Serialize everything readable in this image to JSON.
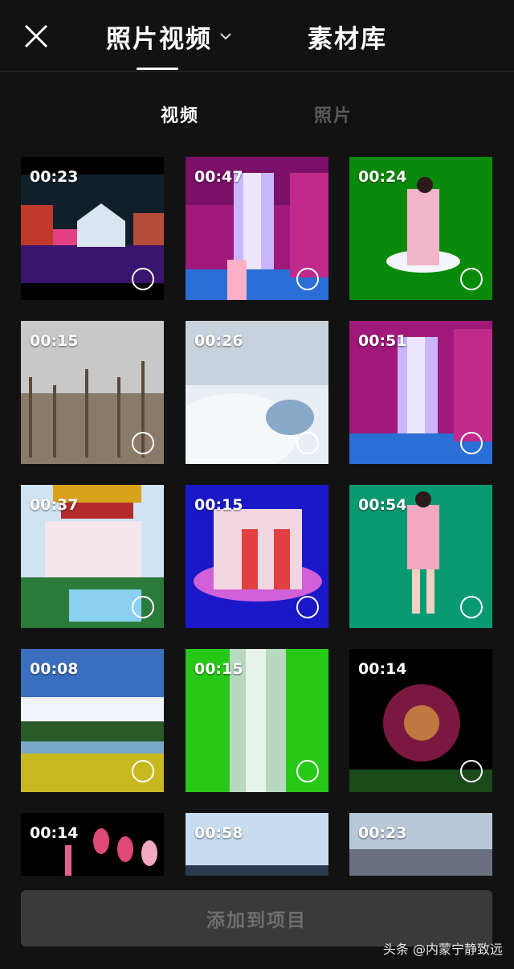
{
  "header": {
    "close_icon": "close-icon",
    "tab_primary": "照片视频",
    "tab_secondary": "素材库"
  },
  "subtabs": {
    "active": "视频",
    "inactive": "照片"
  },
  "tiles": [
    {
      "duration": "00:23"
    },
    {
      "duration": "00:47"
    },
    {
      "duration": "00:24"
    },
    {
      "duration": "00:15"
    },
    {
      "duration": "00:26"
    },
    {
      "duration": "00:51"
    },
    {
      "duration": "00:37"
    },
    {
      "duration": "00:15"
    },
    {
      "duration": "00:54"
    },
    {
      "duration": "00:08"
    },
    {
      "duration": "00:15"
    },
    {
      "duration": "00:14"
    },
    {
      "duration": "00:14"
    },
    {
      "duration": "00:58"
    },
    {
      "duration": "00:23"
    }
  ],
  "footer": {
    "add_button": "添加到项目"
  },
  "watermark": "头条 @内蒙宁静致远"
}
